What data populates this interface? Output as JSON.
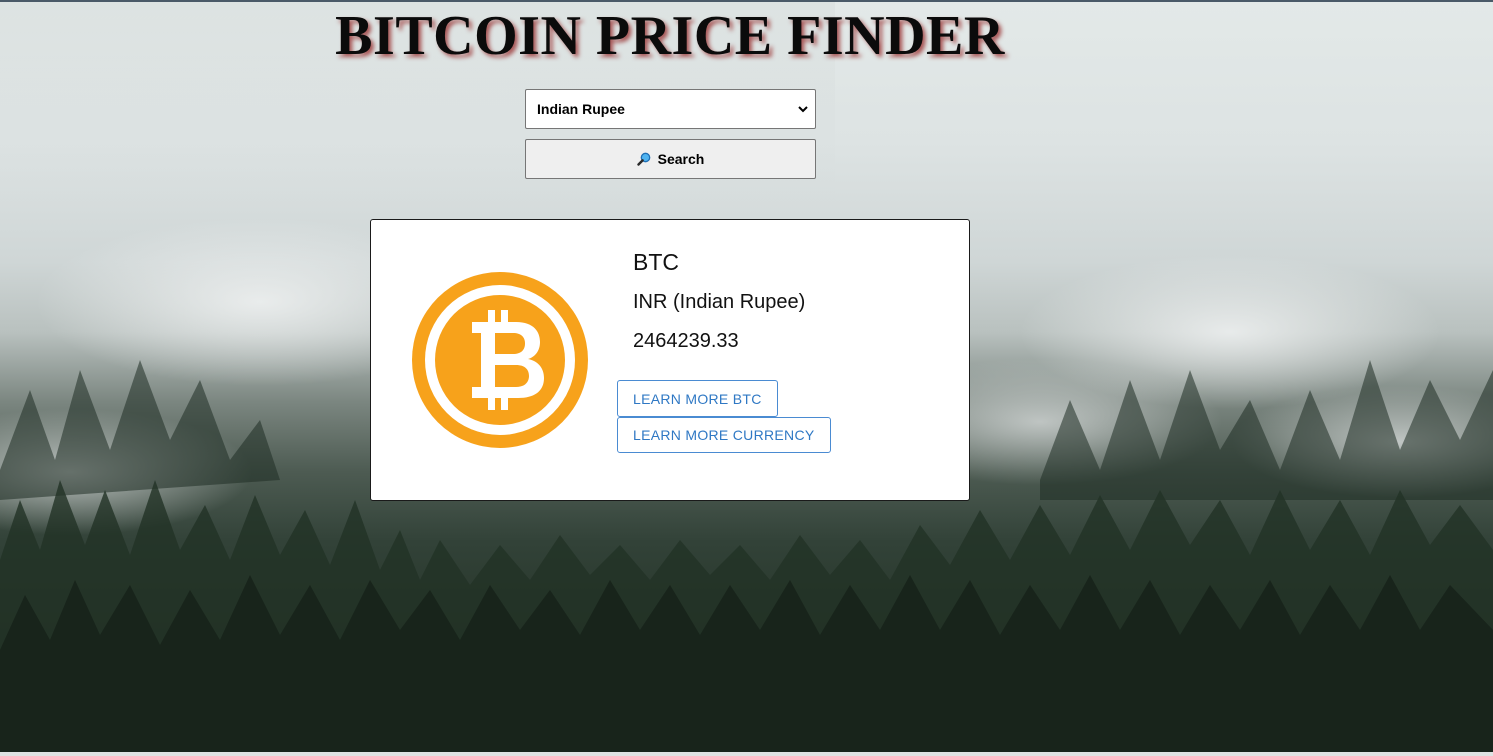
{
  "header": {
    "title": "BITCOIN PRICE FINDER"
  },
  "form": {
    "currency_select": {
      "selected": "Indian Rupee",
      "chevron_icon": "chevron-down-icon"
    },
    "search_button": {
      "label": "Search",
      "icon": "magnifier-icon"
    }
  },
  "result_card": {
    "logo_icon": "bitcoin-logo",
    "coin_code": "BTC",
    "currency": "INR (Indian Rupee)",
    "price": "2464239.33",
    "buttons": {
      "learn_btc": "LEARN MORE BTC",
      "learn_currency": "LEARN MORE CURRENCY"
    }
  },
  "colors": {
    "bitcoin_orange": "#f7a21b",
    "link_blue": "#2f78c4",
    "title_shadow": "#962828"
  }
}
